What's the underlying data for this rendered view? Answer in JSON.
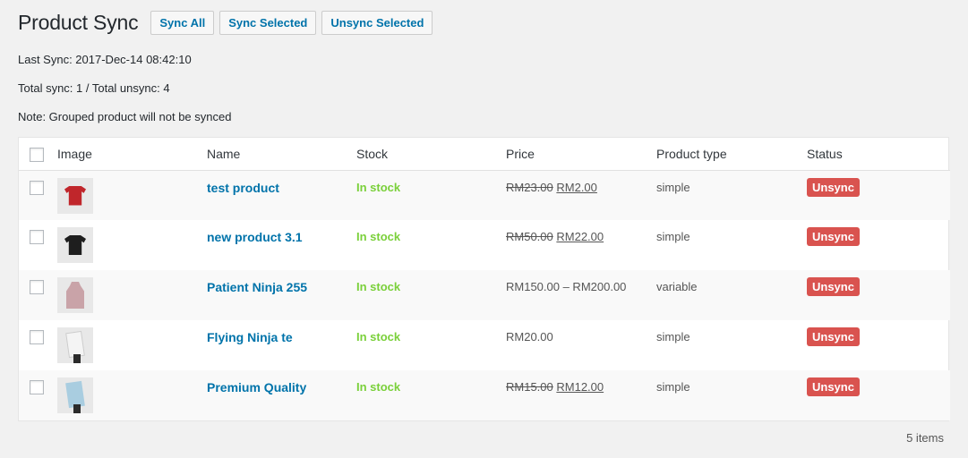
{
  "header": {
    "title": "Product Sync",
    "buttons": [
      "Sync All",
      "Sync Selected",
      "Unsync Selected"
    ]
  },
  "info": {
    "last_sync": "Last Sync: 2017-Dec-14 08:42:10",
    "totals": "Total sync: 1 / Total unsync: 4",
    "note": "Note: Grouped product will not be synced"
  },
  "table": {
    "columns": [
      "Image",
      "Name",
      "Stock",
      "Price",
      "Product type",
      "Status"
    ],
    "rows": [
      {
        "image": "red-tshirt",
        "name": "test product",
        "stock": "In stock",
        "price_old": "RM23.00",
        "price_new": "RM2.00",
        "price": "",
        "type": "simple",
        "status": "Unsync"
      },
      {
        "image": "black-tshirt",
        "name": "new product 3.1",
        "stock": "In stock",
        "price_old": "RM50.00",
        "price_new": "RM22.00",
        "price": "",
        "type": "simple",
        "status": "Unsync"
      },
      {
        "image": "pink-hoodie",
        "name": "Patient Ninja 255",
        "stock": "In stock",
        "price_old": "",
        "price_new": "",
        "price": "RM150.00 – RM200.00",
        "type": "variable",
        "status": "Unsync"
      },
      {
        "image": "poster-white",
        "name": "Flying Ninja te",
        "stock": "In stock",
        "price_old": "",
        "price_new": "",
        "price": "RM20.00",
        "type": "simple",
        "status": "Unsync"
      },
      {
        "image": "poster-blue",
        "name": "Premium Quality",
        "stock": "In stock",
        "price_old": "RM15.00",
        "price_new": "RM12.00",
        "price": "",
        "type": "simple",
        "status": "Unsync"
      }
    ]
  },
  "footer": {
    "items": "5 items"
  },
  "colors": {
    "link": "#0073aa",
    "in_stock": "#7ad03a",
    "unsync_badge": "#d9534f"
  }
}
